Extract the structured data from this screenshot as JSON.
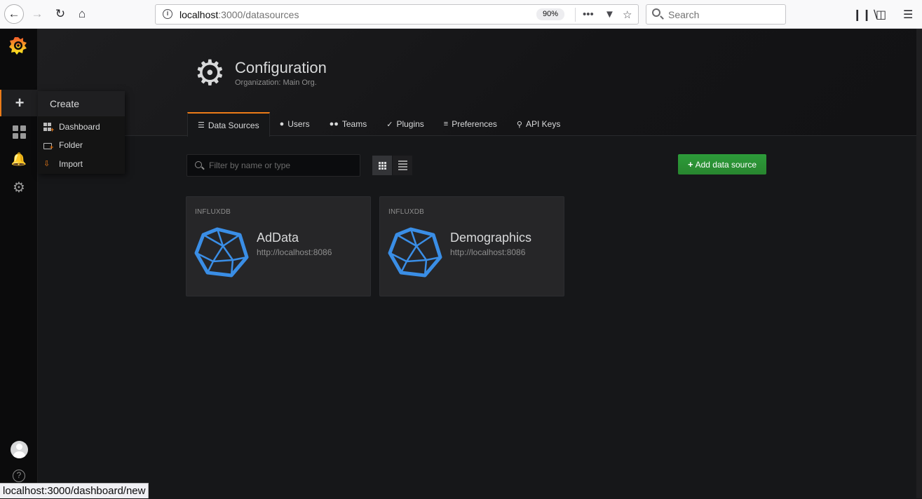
{
  "browser": {
    "url_host": "localhost",
    "url_path": ":3000/datasources",
    "zoom": "90%",
    "search_placeholder": "Search",
    "status_url": "localhost:3000/dashboard/new"
  },
  "sidebar": {
    "create_menu": {
      "title": "Create",
      "items": [
        {
          "label": "Dashboard",
          "icon": "dashboard-icon"
        },
        {
          "label": "Folder",
          "icon": "folder-icon"
        },
        {
          "label": "Import",
          "icon": "import-icon"
        }
      ]
    },
    "icons": [
      "grafana-logo",
      "plus-icon",
      "dashboards-icon",
      "bell-icon",
      "gear-icon",
      "avatar",
      "help-icon"
    ]
  },
  "header": {
    "title": "Configuration",
    "subtitle": "Organization: Main Org."
  },
  "tabs": [
    {
      "label": "Data Sources",
      "icon": "database-icon",
      "active": true
    },
    {
      "label": "Users",
      "icon": "user-icon"
    },
    {
      "label": "Teams",
      "icon": "users-icon"
    },
    {
      "label": "Plugins",
      "icon": "plug-icon"
    },
    {
      "label": "Preferences",
      "icon": "sliders-icon"
    },
    {
      "label": "API Keys",
      "icon": "key-icon"
    }
  ],
  "toolbar": {
    "filter_placeholder": "Filter by name or type",
    "add_label": "Add data source"
  },
  "datasources": [
    {
      "type": "INFLUXDB",
      "name": "AdData",
      "url": "http://localhost:8086"
    },
    {
      "type": "INFLUXDB",
      "name": "Demographics",
      "url": "http://localhost:8086"
    }
  ],
  "colors": {
    "accent": "#eb7b18",
    "add_button": "#299c46",
    "influx_blue": "#3a8ee6"
  }
}
